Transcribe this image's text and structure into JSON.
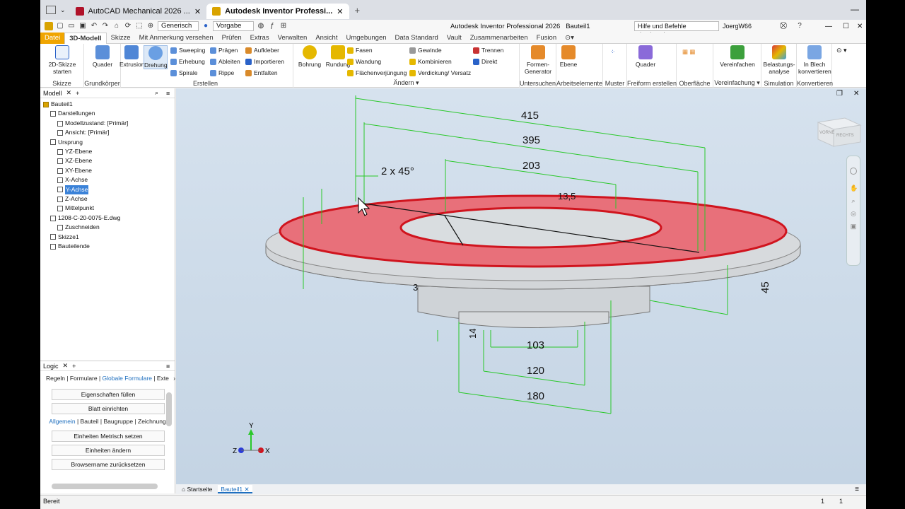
{
  "browser": {
    "tabs": [
      {
        "label": "AutoCAD Mechanical 2026 ...",
        "color": "#b0122a"
      },
      {
        "label": "Autodesk Inventor Professi...",
        "color": "#d9a300"
      }
    ]
  },
  "app": {
    "title": "Autodesk Inventor Professional 2026",
    "document": "Bauteil1",
    "search_placeholder": "Hilfe und Befehle durchsuchen...",
    "user": "JoergW66",
    "material": "Generisch",
    "appearance": "Vorgabe"
  },
  "ribbon_tabs": [
    "Datei",
    "3D-Modell",
    "Skizze",
    "Mit Anmerkung versehen",
    "Prüfen",
    "Extras",
    "Verwalten",
    "Ansicht",
    "Umgebungen",
    "Data Standard",
    "Vault",
    "Zusammenarbeiten",
    "Fusion"
  ],
  "ribbon": {
    "skizze": {
      "btn": "2D-Skizze starten",
      "label": "Skizze"
    },
    "grund": {
      "btn": "Quader",
      "label": "Grundkörper"
    },
    "erstellen": {
      "extrusion": "Extrusion",
      "drehung": "Drehung",
      "sweeping": "Sweeping",
      "erhebung": "Erhebung",
      "spirale": "Spirale",
      "praegen": "Prägen",
      "ableiten": "Ableiten",
      "rippe": "Rippe",
      "aufkleber": "Aufkleber",
      "importieren": "Importieren",
      "entfalten": "Entfalten",
      "label": "Erstellen"
    },
    "aendern": {
      "bohrung": "Bohrung",
      "rundung": "Rundung",
      "fasen": "Fasen",
      "wandung": "Wandung",
      "flaechen": "Flächenverjüngung",
      "gewinde": "Gewinde",
      "kombinieren": "Kombinieren",
      "verdickung": "Verdickung/ Versatz",
      "trennen": "Trennen",
      "direkt": "Direkt",
      "label": "Ändern"
    },
    "untersuchen": {
      "btn": "Formen-Generator",
      "label": "Untersuchen"
    },
    "arbeit": {
      "btn": "Ebene",
      "label": "Arbeitselemente"
    },
    "muster": {
      "label": "Muster"
    },
    "freiform": {
      "btn": "Quader",
      "label": "Freiform erstellen"
    },
    "oberflaeche": {
      "label": "Oberfläche"
    },
    "vereinfachung": {
      "btn": "Vereinfachen",
      "label": "Vereinfachung"
    },
    "simulation": {
      "btn": "Belastungs-analyse",
      "label": "Simulation"
    },
    "konvertieren": {
      "btn": "In Blech konvertieren",
      "label": "Konvertieren"
    }
  },
  "model_panel": {
    "title": "Modell",
    "tree": [
      {
        "label": "Bauteil1",
        "level": 0
      },
      {
        "label": "Darstellungen",
        "level": 1
      },
      {
        "label": "Modellzustand: [Primär]",
        "level": 2
      },
      {
        "label": "Ansicht: [Primär]",
        "level": 2
      },
      {
        "label": "Ursprung",
        "level": 1
      },
      {
        "label": "YZ-Ebene",
        "level": 2
      },
      {
        "label": "XZ-Ebene",
        "level": 2
      },
      {
        "label": "XY-Ebene",
        "level": 2
      },
      {
        "label": "X-Achse",
        "level": 2
      },
      {
        "label": "Y-Achse",
        "level": 2,
        "selected": true
      },
      {
        "label": "Z-Achse",
        "level": 2
      },
      {
        "label": "Mittelpunkt",
        "level": 2
      },
      {
        "label": "1208-C-20-0075-E.dwg",
        "level": 1
      },
      {
        "label": "Zuschneiden",
        "level": 2
      },
      {
        "label": "Skizze1",
        "level": 1
      },
      {
        "label": "Bauteilende",
        "level": 1
      }
    ]
  },
  "logic_panel": {
    "title": "Logic",
    "nav1": [
      "Regeln",
      "Formulare",
      "Globale Formulare",
      "Exte"
    ],
    "buttons1": [
      "Eigenschaften füllen",
      "Blatt einrichten"
    ],
    "nav2": [
      "Allgemein",
      "Bauteil",
      "Baugruppe",
      "Zeichnung"
    ],
    "buttons2": [
      "Einheiten Metrisch setzen",
      "Einheiten ändern",
      "Browsername zurücksetzen"
    ]
  },
  "dimensions": [
    "415",
    "395",
    "203",
    "2 x 45°",
    "13,5",
    "45",
    "14",
    "3",
    "103",
    "120",
    "180"
  ],
  "viewcube": {
    "front": "VORNE",
    "right": "RECHTS"
  },
  "axes": {
    "x": "X",
    "y": "Y",
    "z": "Z"
  },
  "doc_tabs": [
    "Startseite",
    "Bauteil1"
  ],
  "status": {
    "left": "Bereit",
    "n1": "1",
    "n2": "1"
  },
  "colors": {
    "accent": "#1e6fbf",
    "face": "#e8707a",
    "edge": "#d0141e",
    "dim": "#29c829"
  }
}
